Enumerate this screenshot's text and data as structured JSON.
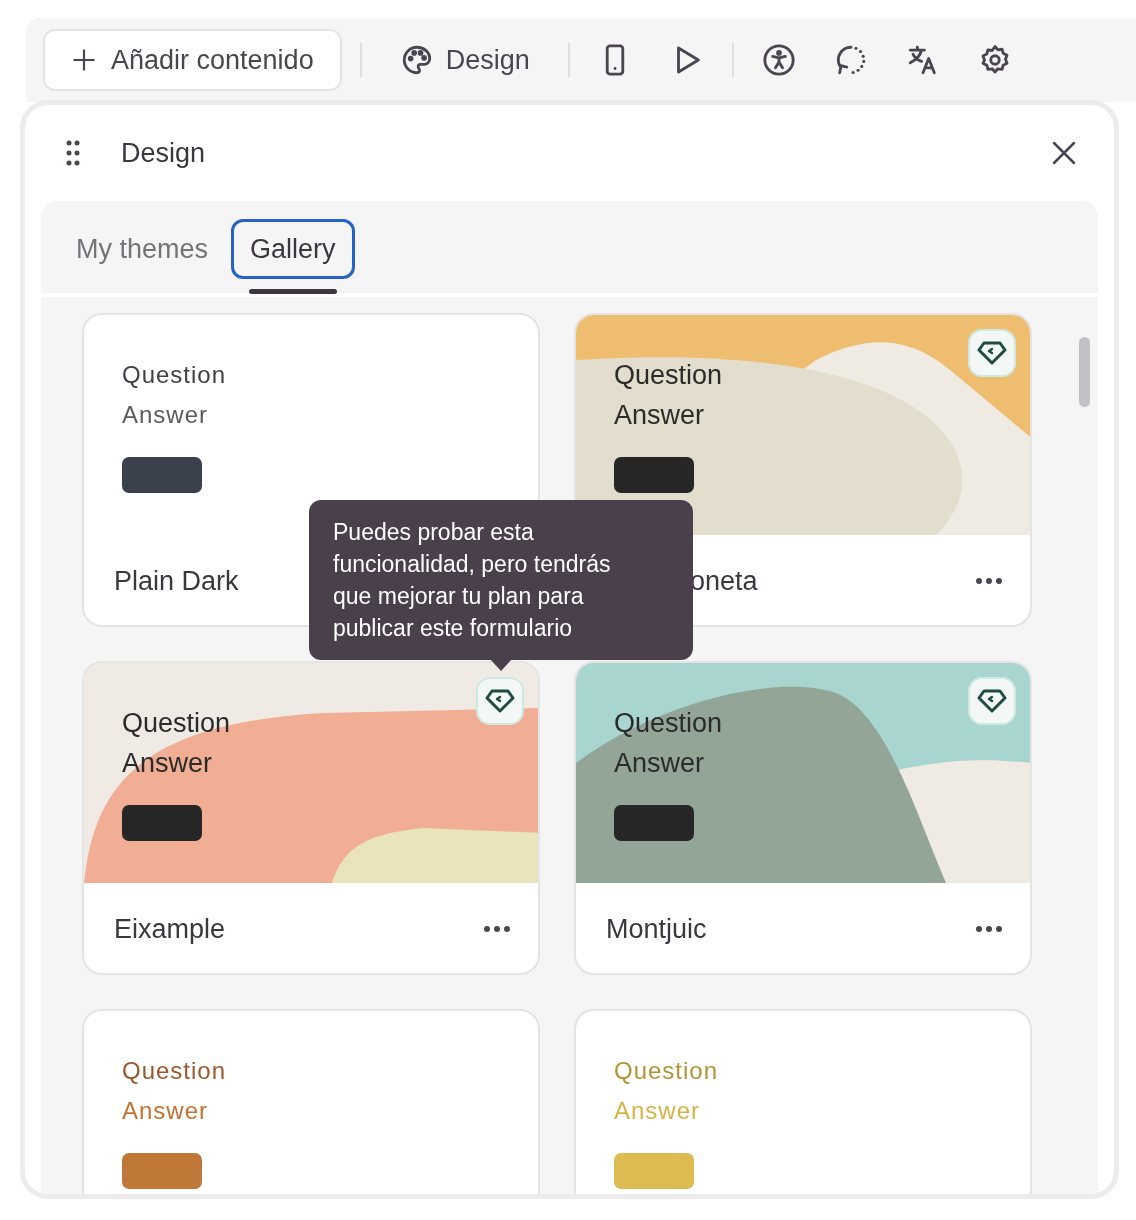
{
  "toolbar": {
    "add_label": "Añadir contenido",
    "design_label": "Design"
  },
  "panel": {
    "title": "Design",
    "tabs": [
      {
        "label": "My themes",
        "selected": false
      },
      {
        "label": "Gallery",
        "selected": true
      }
    ],
    "cards": [
      {
        "kind": "plain",
        "question": {
          "text": "Question",
          "color": "#3f3f46"
        },
        "answer": {
          "text": "Answer",
          "color": "#5b5b5b"
        },
        "button": {
          "color": "#3a414c"
        },
        "name": "Plain Dark",
        "premium": false,
        "covered": false
      },
      {
        "kind": "dunes",
        "question": {
          "text": "Question",
          "color": "#2b2b2b"
        },
        "answer": {
          "text": "Answer",
          "color": "#2b2b2b"
        },
        "button": {
          "color": "#262626"
        },
        "name": "oneta",
        "premium": true,
        "covered": true
      },
      {
        "kind": "waves",
        "question": {
          "text": "Question",
          "color": "#2b2b2b"
        },
        "answer": {
          "text": "Answer",
          "color": "#2b2b2b"
        },
        "button": {
          "color": "#262626"
        },
        "name": "Eixample",
        "premium": true,
        "covered": false
      },
      {
        "kind": "hills",
        "question": {
          "text": "Question",
          "color": "#2b2b2b"
        },
        "answer": {
          "text": "Answer",
          "color": "#2b2b2b"
        },
        "button": {
          "color": "#262626"
        },
        "name": "Montjuic",
        "premium": true,
        "covered": false
      },
      {
        "kind": "plain",
        "question": {
          "text": "Question",
          "color": "#9c5a2a"
        },
        "answer": {
          "text": "Answer",
          "color": "#c5702e"
        },
        "button": {
          "color": "#c07838"
        },
        "premium": false
      },
      {
        "kind": "plain",
        "question": {
          "text": "Question",
          "color": "#b39432"
        },
        "answer": {
          "text": "Answer",
          "color": "#d6b444"
        },
        "button": {
          "color": "#dcbc50"
        },
        "premium": false
      }
    ],
    "tooltip": "Puedes probar esta funcionalidad, pero tendrás que mejorar tu plan para publicar este formulario"
  }
}
